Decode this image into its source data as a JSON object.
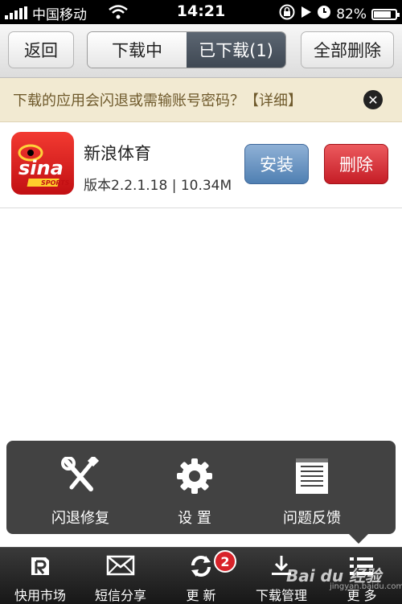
{
  "status_bar": {
    "carrier": "中国移动",
    "time": "14:21",
    "battery_percent": "82%",
    "battery_level": 0.82,
    "signal_bars": 5,
    "icons": [
      "wifi-icon",
      "rotation-lock-icon",
      "play-icon",
      "alarm-icon",
      "battery-icon"
    ]
  },
  "nav": {
    "back_label": "返回",
    "tabs": [
      {
        "label": "下载中",
        "selected": false
      },
      {
        "label": "已下载(1)",
        "selected": true
      }
    ],
    "delete_all_label": "全部删除"
  },
  "notice": {
    "text": "下载的应用会闪退或需输账号密码？【详细】",
    "close_icon": "close-icon"
  },
  "downloads": [
    {
      "name": "新浪体育",
      "icon_text": "sina",
      "icon_subtext": "SPORTS",
      "meta": "版本2.2.1.18 | 10.34M",
      "install_label": "安装",
      "delete_label": "删除"
    }
  ],
  "popup_menu": {
    "items": [
      {
        "label": "闪退修复",
        "icon": "repair-tools-icon"
      },
      {
        "label": "设 置",
        "icon": "gear-icon"
      },
      {
        "label": "问题反馈",
        "icon": "feedback-icon"
      }
    ]
  },
  "tab_bar": {
    "items": [
      {
        "label": "快用市场",
        "icon": "market-icon"
      },
      {
        "label": "短信分享",
        "icon": "envelope-icon"
      },
      {
        "label": "更 新",
        "icon": "refresh-icon",
        "badge": "2"
      },
      {
        "label": "下载管理",
        "icon": "download-icon"
      },
      {
        "label": "更 多",
        "icon": "list-icon"
      }
    ]
  },
  "watermark": {
    "text": "Bai du 经验",
    "sub": "jingyan.baidu.com"
  },
  "colors": {
    "notice_bg": "#f2ead2",
    "install_blue": "#4f7fb2",
    "delete_red": "#c51d26",
    "selected_tab": "#3f4853"
  }
}
